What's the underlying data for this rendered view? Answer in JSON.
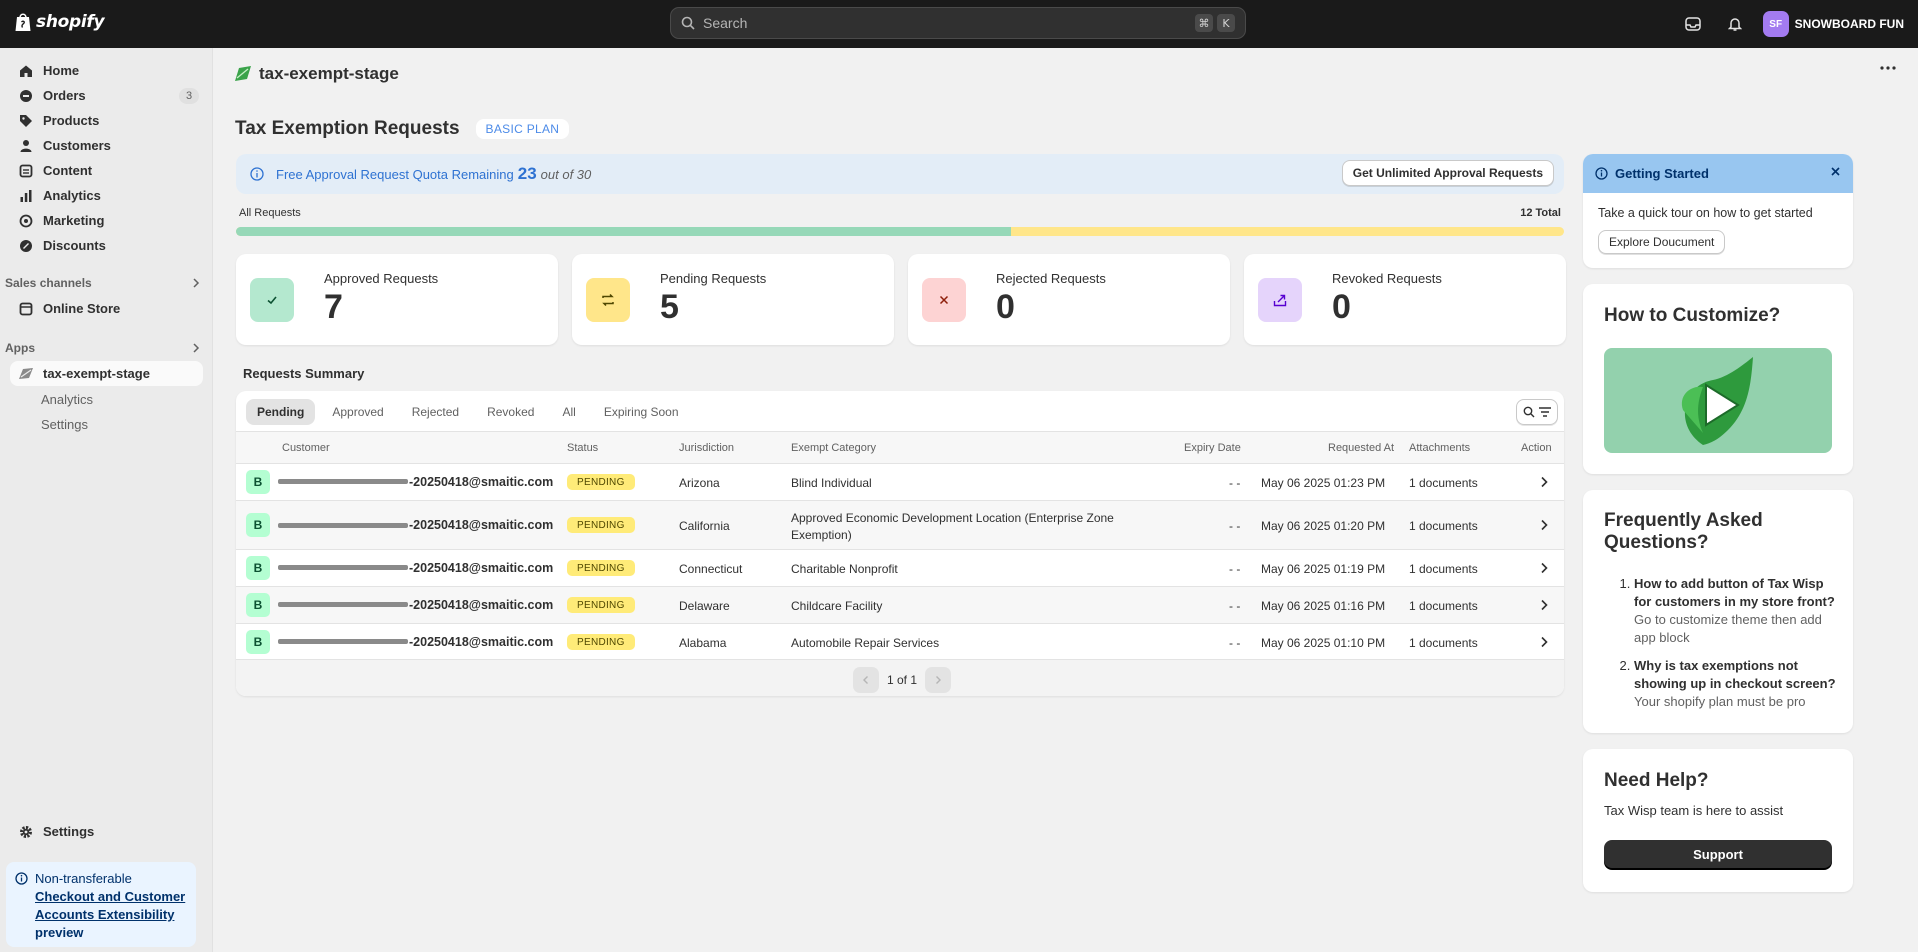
{
  "topbar": {
    "brand": "shopify",
    "search_placeholder": "Search",
    "shortcut_cmd": "⌘",
    "shortcut_key": "K",
    "store_initials": "SF",
    "store_name": "SNOWBOARD FUN"
  },
  "sidebar": {
    "items": [
      {
        "label": "Home",
        "icon": "home-icon"
      },
      {
        "label": "Orders",
        "icon": "orders-icon",
        "badge": "3"
      },
      {
        "label": "Products",
        "icon": "tag-icon"
      },
      {
        "label": "Customers",
        "icon": "person-icon"
      },
      {
        "label": "Content",
        "icon": "content-icon"
      },
      {
        "label": "Analytics",
        "icon": "chart-icon"
      },
      {
        "label": "Marketing",
        "icon": "target-icon"
      },
      {
        "label": "Discounts",
        "icon": "discount-icon"
      }
    ],
    "sales_channels_label": "Sales channels",
    "online_store": "Online Store",
    "apps_label": "Apps",
    "app_name": "tax-exempt-stage",
    "app_sub": [
      "Analytics",
      "Settings"
    ],
    "settings": "Settings",
    "notice": {
      "title": "Non-transferable",
      "link": "Checkout and Customer Accounts Extensibility",
      "suffix": "preview"
    }
  },
  "header": {
    "app_title": "tax-exempt-stage"
  },
  "page": {
    "title": "Tax Exemption Requests",
    "plan": "BASIC PLAN",
    "quota": {
      "text": "Free Approval Request Quota Remaining",
      "remaining": "23",
      "of": "out of 30",
      "button": "Get Unlimited Approval Requests"
    },
    "progress": {
      "label": "All Requests",
      "total": "12 Total",
      "approved_fraction": 0.5833
    },
    "stats": [
      {
        "label": "Approved Requests",
        "value": "7",
        "icon": "check-icon",
        "bg": "#b4e8cf",
        "fg": "#0c5132"
      },
      {
        "label": "Pending Requests",
        "value": "5",
        "icon": "swap-icon",
        "bg": "#ffe68a",
        "fg": "#4f4700"
      },
      {
        "label": "Rejected Requests",
        "value": "0",
        "icon": "x-icon",
        "bg": "#fdd3d3",
        "fg": "#8e1f0b"
      },
      {
        "label": "Revoked Requests",
        "value": "0",
        "icon": "share-icon",
        "bg": "#e5d4fb",
        "fg": "#5700d1"
      }
    ],
    "summary_title": "Requests Summary",
    "tabs": [
      "Pending",
      "Approved",
      "Rejected",
      "Revoked",
      "All",
      "Expiring Soon"
    ],
    "columns": [
      "Customer",
      "Status",
      "Jurisdiction",
      "Exempt Category",
      "Expiry Date",
      "Requested At",
      "Attachments",
      "Action"
    ],
    "rows": [
      {
        "initial": "B",
        "email": "-20250418@smaitic.com",
        "status": "PENDING",
        "jurisdiction": "Arizona",
        "category": "Blind Individual",
        "expiry": "- -",
        "requested": "May 06 2025 01:23 PM",
        "attachments": "1 documents"
      },
      {
        "initial": "B",
        "email": "-20250418@smaitic.com",
        "status": "PENDING",
        "jurisdiction": "California",
        "category": "Approved Economic Development Location (Enterprise Zone Exemption)",
        "expiry": "- -",
        "requested": "May 06 2025 01:20 PM",
        "attachments": "1 documents"
      },
      {
        "initial": "B",
        "email": "-20250418@smaitic.com",
        "status": "PENDING",
        "jurisdiction": "Connecticut",
        "category": "Charitable Nonprofit",
        "expiry": "- -",
        "requested": "May 06 2025 01:19 PM",
        "attachments": "1 documents"
      },
      {
        "initial": "B",
        "email": "-20250418@smaitic.com",
        "status": "PENDING",
        "jurisdiction": "Delaware",
        "category": "Childcare Facility",
        "expiry": "- -",
        "requested": "May 06 2025 01:16 PM",
        "attachments": "1 documents"
      },
      {
        "initial": "B",
        "email": "-20250418@smaitic.com",
        "status": "PENDING",
        "jurisdiction": "Alabama",
        "category": "Automobile Repair Services",
        "expiry": "- -",
        "requested": "May 06 2025 01:10 PM",
        "attachments": "1 documents"
      }
    ],
    "pagination": "1 of 1"
  },
  "right": {
    "getting_started": {
      "title": "Getting Started",
      "text": "Take a quick tour on how to get started",
      "button": "Explore Doucument"
    },
    "customize_title": "How to Customize?",
    "faq_title": "Frequently Asked Questions?",
    "faqs": [
      {
        "q": "How to add button of Tax Wisp for customers in my store front?",
        "a": "Go to customize theme then add app block"
      },
      {
        "q": "Why is tax exemptions not showing up in checkout screen?",
        "a": "Your shopify plan must be pro"
      }
    ],
    "help_title": "Need Help?",
    "help_text": "Tax Wisp team is here to assist",
    "support_button": "Support"
  },
  "colors": {
    "approved": "#96d8b8",
    "pending": "#ffe68a",
    "accent": "#2e72d2",
    "topbar": "#1a1a1a"
  }
}
